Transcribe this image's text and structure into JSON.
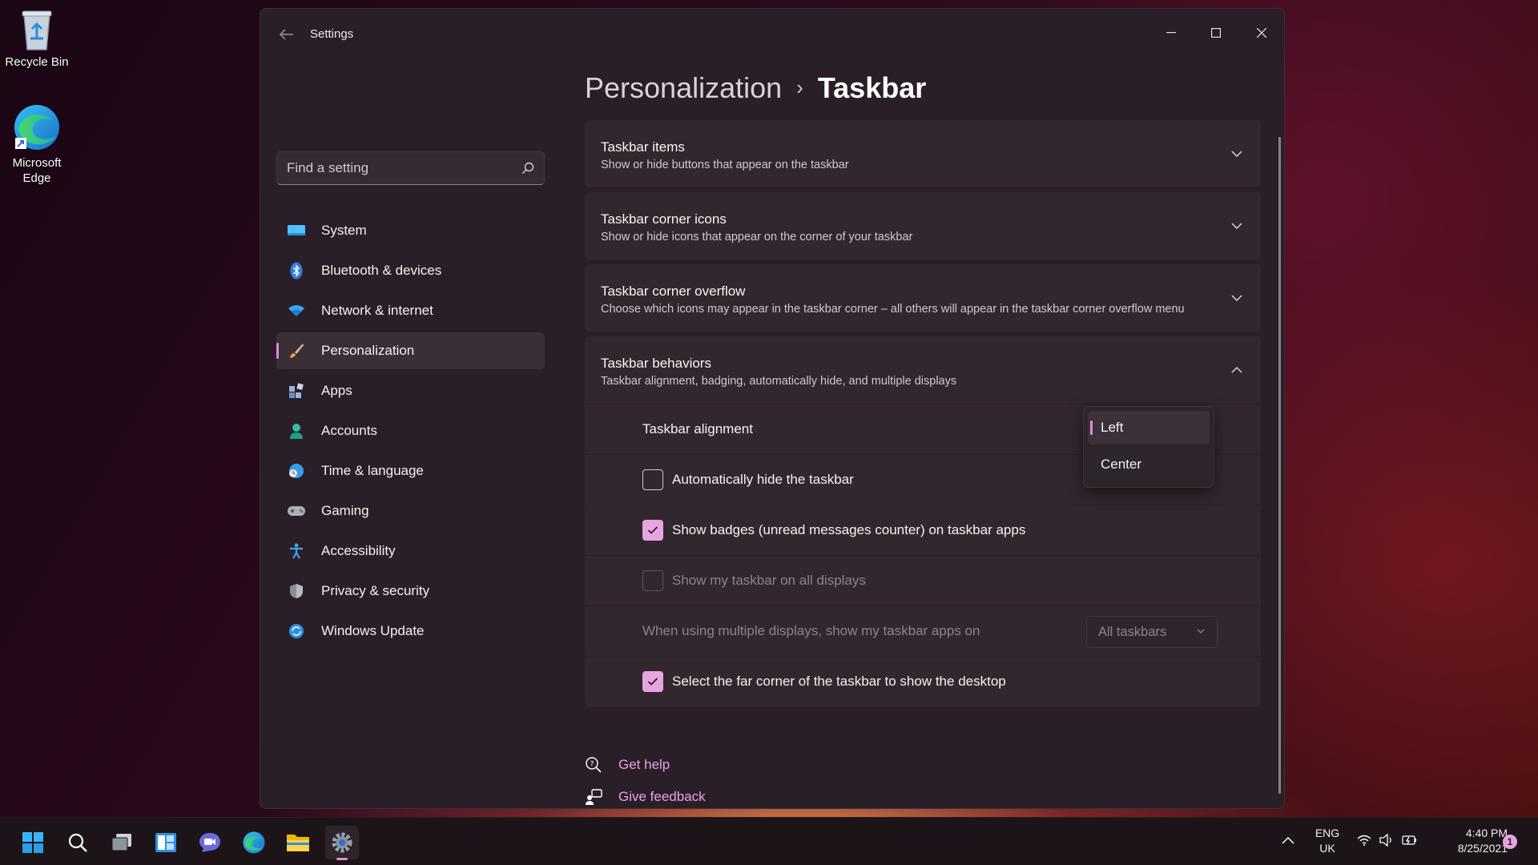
{
  "desktop": {
    "icons": [
      {
        "label": "Recycle Bin",
        "icon": "recycle-bin-icon"
      },
      {
        "label": "Microsoft Edge",
        "icon": "edge-icon"
      }
    ]
  },
  "window": {
    "title": "Settings",
    "controls": {
      "minimize": "—",
      "maximize": "☐",
      "close": "✕"
    }
  },
  "search": {
    "placeholder": "Find a setting"
  },
  "nav": {
    "items": [
      {
        "label": "System",
        "icon": "system-icon"
      },
      {
        "label": "Bluetooth & devices",
        "icon": "bluetooth-icon"
      },
      {
        "label": "Network & internet",
        "icon": "wifi-icon"
      },
      {
        "label": "Personalization",
        "icon": "brush-icon",
        "active": true
      },
      {
        "label": "Apps",
        "icon": "apps-icon"
      },
      {
        "label": "Accounts",
        "icon": "account-icon"
      },
      {
        "label": "Time & language",
        "icon": "globe-clock-icon"
      },
      {
        "label": "Gaming",
        "icon": "gamepad-icon"
      },
      {
        "label": "Accessibility",
        "icon": "accessibility-icon"
      },
      {
        "label": "Privacy & security",
        "icon": "shield-icon"
      },
      {
        "label": "Windows Update",
        "icon": "update-icon"
      }
    ]
  },
  "breadcrumb": {
    "parent": "Personalization",
    "separator": "›",
    "current": "Taskbar"
  },
  "cards": [
    {
      "title": "Taskbar items",
      "subtitle": "Show or hide buttons that appear on the taskbar",
      "expanded": false
    },
    {
      "title": "Taskbar corner icons",
      "subtitle": "Show or hide icons that appear on the corner of your taskbar",
      "expanded": false
    },
    {
      "title": "Taskbar corner overflow",
      "subtitle": "Choose which icons may appear in the taskbar corner – all others will appear in the taskbar corner overflow menu",
      "expanded": false
    },
    {
      "title": "Taskbar behaviors",
      "subtitle": "Taskbar alignment, badging, automatically hide, and multiple displays",
      "expanded": true
    }
  ],
  "behaviors": {
    "alignment_label": "Taskbar alignment",
    "alignment_options": [
      "Left",
      "Center"
    ],
    "alignment_selected": "Left",
    "auto_hide": {
      "label": "Automatically hide the taskbar",
      "checked": false
    },
    "badges": {
      "label": "Show badges (unread messages counter) on taskbar apps",
      "checked": true
    },
    "all_displays": {
      "label": "Show my taskbar on all displays",
      "checked": false,
      "disabled": true
    },
    "multi_display": {
      "label": "When using multiple displays, show my taskbar apps on",
      "value": "All taskbars",
      "disabled": true
    },
    "far_corner": {
      "label": "Select the far corner of the taskbar to show the desktop",
      "checked": true
    }
  },
  "links": {
    "help": "Get help",
    "feedback": "Give feedback"
  },
  "taskbar": {
    "apps": [
      "start-icon",
      "search-icon",
      "task-view-icon",
      "widgets-icon",
      "chat-icon",
      "edge-icon",
      "file-explorer-icon",
      "settings-icon"
    ],
    "lang_top": "ENG",
    "lang_bottom": "UK",
    "time": "4:40 PM",
    "date": "8/25/2021",
    "notification_count": "1"
  },
  "colors": {
    "accent": "#e8a4e0",
    "window_bg": "#2a1f28",
    "card_bg": "#33272f"
  }
}
